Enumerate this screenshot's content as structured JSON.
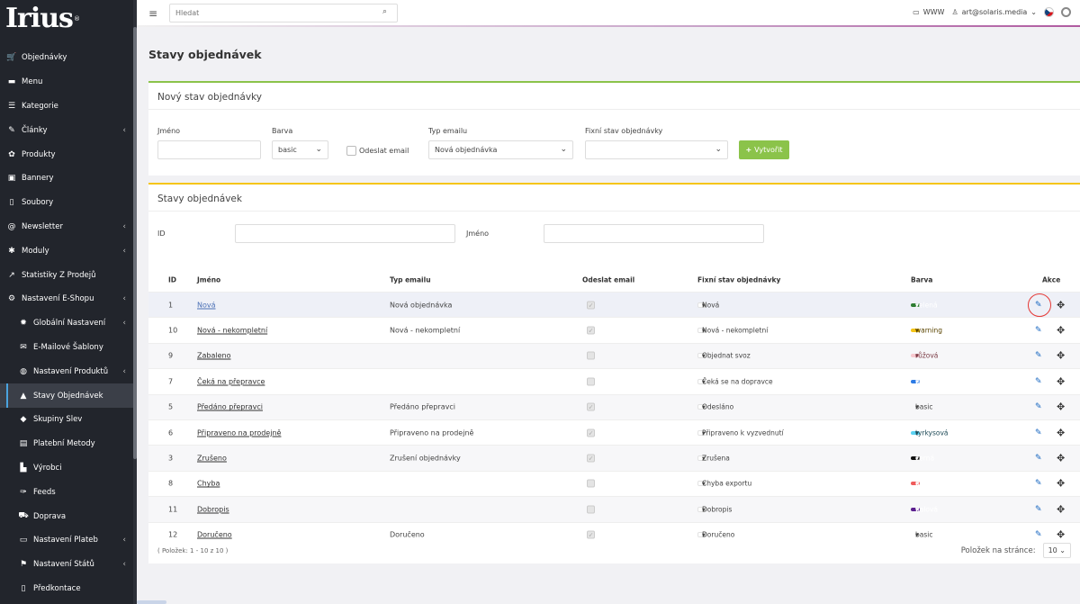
{
  "brand": {
    "logo": "Irius",
    "reg": "®"
  },
  "sidebar": {
    "items": [
      {
        "label": "Objednávky",
        "icon": "cart-icon",
        "glyph": "🛒",
        "sub": false,
        "chev": false
      },
      {
        "label": "Menu",
        "icon": "folder-icon",
        "glyph": "▬",
        "sub": false,
        "chev": false
      },
      {
        "label": "Kategorie",
        "icon": "list-icon",
        "glyph": "☰",
        "sub": false,
        "chev": false
      },
      {
        "label": "Články",
        "icon": "pencil-icon",
        "glyph": "✎",
        "sub": false,
        "chev": true
      },
      {
        "label": "Produkty",
        "icon": "gift-icon",
        "glyph": "✿",
        "sub": false,
        "chev": false
      },
      {
        "label": "Bannery",
        "icon": "image-icon",
        "glyph": "▣",
        "sub": false,
        "chev": false
      },
      {
        "label": "Soubory",
        "icon": "file-icon",
        "glyph": "▯",
        "sub": false,
        "chev": false
      },
      {
        "label": "Newsletter",
        "icon": "at-icon",
        "glyph": "@",
        "sub": false,
        "chev": true
      },
      {
        "label": "Moduly",
        "icon": "puzzle-icon",
        "glyph": "✱",
        "sub": false,
        "chev": true
      },
      {
        "label": "Statistiky Z Prodejů",
        "icon": "chart-icon",
        "glyph": "↗",
        "sub": false,
        "chev": false
      },
      {
        "label": "Nastavení E-Shopu",
        "icon": "toggle-icon",
        "glyph": "⚙",
        "sub": false,
        "chev": true
      },
      {
        "label": "Globální Nastavení",
        "icon": "cog-icon",
        "glyph": "✹",
        "sub": true,
        "chev": true
      },
      {
        "label": "E-Mailové Šablony",
        "icon": "envelope-icon",
        "glyph": "✉",
        "sub": true,
        "chev": false
      },
      {
        "label": "Nastavení Produktů",
        "icon": "basketball-icon",
        "glyph": "◍",
        "sub": true,
        "chev": true
      },
      {
        "label": "Stavy Objednávek",
        "icon": "bell-icon",
        "glyph": "▲",
        "sub": true,
        "chev": false,
        "active": true
      },
      {
        "label": "Skupiny Slev",
        "icon": "tag-icon",
        "glyph": "◆",
        "sub": true,
        "chev": false
      },
      {
        "label": "Platební Metody",
        "icon": "money-icon",
        "glyph": "▤",
        "sub": true,
        "chev": false
      },
      {
        "label": "Výrobci",
        "icon": "building-icon",
        "glyph": "▙",
        "sub": true,
        "chev": false
      },
      {
        "label": "Feeds",
        "icon": "feather-icon",
        "glyph": "✑",
        "sub": true,
        "chev": false
      },
      {
        "label": "Doprava",
        "icon": "truck-icon",
        "glyph": "⛟",
        "sub": true,
        "chev": false
      },
      {
        "label": "Nastavení Plateb",
        "icon": "card-icon",
        "glyph": "▭",
        "sub": true,
        "chev": true
      },
      {
        "label": "Nastavení Států",
        "icon": "flag-icon",
        "glyph": "⚑",
        "sub": true,
        "chev": true
      },
      {
        "label": "Předkontace",
        "icon": "document-icon",
        "glyph": "▯",
        "sub": true,
        "chev": false
      }
    ]
  },
  "topbar": {
    "search_placeholder": "Hledat",
    "www": "WWW",
    "user": "art@solaris.media"
  },
  "page": {
    "title": "Stavy objednávek"
  },
  "form": {
    "header": "Nový stav objednávky",
    "name_label": "Jméno",
    "color_label": "Barva",
    "color_value": "basic",
    "send_email_label": "Odeslat email",
    "email_type_label": "Typ emailu",
    "email_type_value": "Nová objednávka",
    "fixed_state_label": "Fixní stav objednávky",
    "fixed_state_value": "",
    "create_label": "Vytvořit"
  },
  "list": {
    "header": "Stavy objednávek",
    "filter": {
      "id_label": "ID",
      "name_label": "Jméno"
    },
    "columns": {
      "id": "ID",
      "name": "Jméno",
      "email_type": "Typ emailu",
      "send_email": "Odeslat email",
      "fixed_state": "Fixní stav objednávky",
      "color": "Barva",
      "actions": "Akce"
    },
    "rows": [
      {
        "id": "1",
        "name": "Nová",
        "email_type": "Nová objednávka",
        "send": true,
        "fixed": "Nová",
        "color": "zelená",
        "bg": "#2e7d32",
        "fg": "#ffffff"
      },
      {
        "id": "10",
        "name": "Nová - nekompletní",
        "email_type": "Nová - nekompletní",
        "send": true,
        "fixed": "Nová - nekompletní",
        "color": "warning",
        "bg": "#f5c518",
        "fg": "#5a4400"
      },
      {
        "id": "9",
        "name": "Zabaleno",
        "email_type": "",
        "send": false,
        "fixed": "Objednat svoz",
        "color": "růžová",
        "bg": "#f8c9cf",
        "fg": "#7a3a44"
      },
      {
        "id": "7",
        "name": "Čeká na přepravce",
        "email_type": "",
        "send": false,
        "fixed": "Čeká se na dopravce",
        "color": "primary",
        "bg": "#2d7be5",
        "fg": "#ffffff"
      },
      {
        "id": "5",
        "name": "Předáno přepravci",
        "email_type": "Předáno přepravci",
        "send": true,
        "fixed": "Odesláno",
        "color": "basic",
        "bg": "transparent",
        "fg": "#444444"
      },
      {
        "id": "6",
        "name": "Připraveno na prodejně",
        "email_type": "Připraveno na prodejně",
        "send": true,
        "fixed": "Připraveno k vyzvednutí",
        "color": "tyrkysová",
        "bg": "#5bd2f2",
        "fg": "#1e4a57"
      },
      {
        "id": "3",
        "name": "Zrušeno",
        "email_type": "Zrušení objednávky",
        "send": true,
        "fixed": "Zrušena",
        "color": "černá",
        "bg": "#111111",
        "fg": "#ffffff"
      },
      {
        "id": "8",
        "name": "Chyba",
        "email_type": "",
        "send": false,
        "fixed": "Chyba exportu",
        "color": "danger",
        "bg": "#ef5b5b",
        "fg": "#ffffff"
      },
      {
        "id": "11",
        "name": "Dobropis",
        "email_type": "",
        "send": false,
        "fixed": "Dobropis",
        "color": "fialová",
        "bg": "#5b1f8f",
        "fg": "#ffffff"
      },
      {
        "id": "12",
        "name": "Doručeno",
        "email_type": "Doručeno",
        "send": true,
        "fixed": "Doručeno",
        "color": "basic",
        "bg": "transparent",
        "fg": "#444444"
      }
    ],
    "footer": "( Položek: 1 - 10 z 10 )",
    "per_page_label": "Položek na stránce:",
    "per_page_value": "10"
  }
}
